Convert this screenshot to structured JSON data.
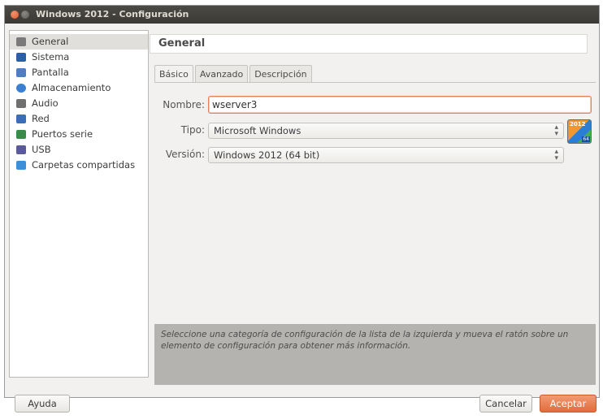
{
  "window": {
    "title": "Windows 2012 - Configuración"
  },
  "sidebar": {
    "items": [
      {
        "label": "General",
        "icon": "general-icon",
        "color": "#7a7a7a"
      },
      {
        "label": "Sistema",
        "icon": "system-icon",
        "color": "#2c5fa8"
      },
      {
        "label": "Pantalla",
        "icon": "display-icon",
        "color": "#4f7fc0"
      },
      {
        "label": "Almacenamiento",
        "icon": "storage-icon",
        "color": "#3b7fd0"
      },
      {
        "label": "Audio",
        "icon": "audio-icon",
        "color": "#6f6f6f"
      },
      {
        "label": "Red",
        "icon": "network-icon",
        "color": "#3a6fb8"
      },
      {
        "label": "Puertos serie",
        "icon": "serial-ports-icon",
        "color": "#3a8a4a"
      },
      {
        "label": "USB",
        "icon": "usb-icon",
        "color": "#5a5a9a"
      },
      {
        "label": "Carpetas compartidas",
        "icon": "shared-folders-icon",
        "color": "#3d8fd8"
      }
    ]
  },
  "header": {
    "title": "General"
  },
  "tabs": [
    "Básico",
    "Avanzado",
    "Descripción"
  ],
  "form": {
    "name_label": "Nombre:",
    "name_value": "wserver3",
    "type_label": "Tipo:",
    "type_value": "Microsoft Windows",
    "version_label": "Versión:",
    "version_value": "Windows 2012 (64 bit)",
    "os_icon_text": "2012",
    "os_icon_badge": "64"
  },
  "info": {
    "text": "Seleccione una categoría de configuración de la lista de la izquierda y mueva el ratón sobre un elemento de configuración para obtener más información."
  },
  "buttons": {
    "help": "Ayuda",
    "cancel": "Cancelar",
    "ok": "Aceptar"
  },
  "colors": {
    "accent": "#e26c3e",
    "titlebar": "#3f3e3a",
    "info_bg": "#b4b3b0"
  }
}
